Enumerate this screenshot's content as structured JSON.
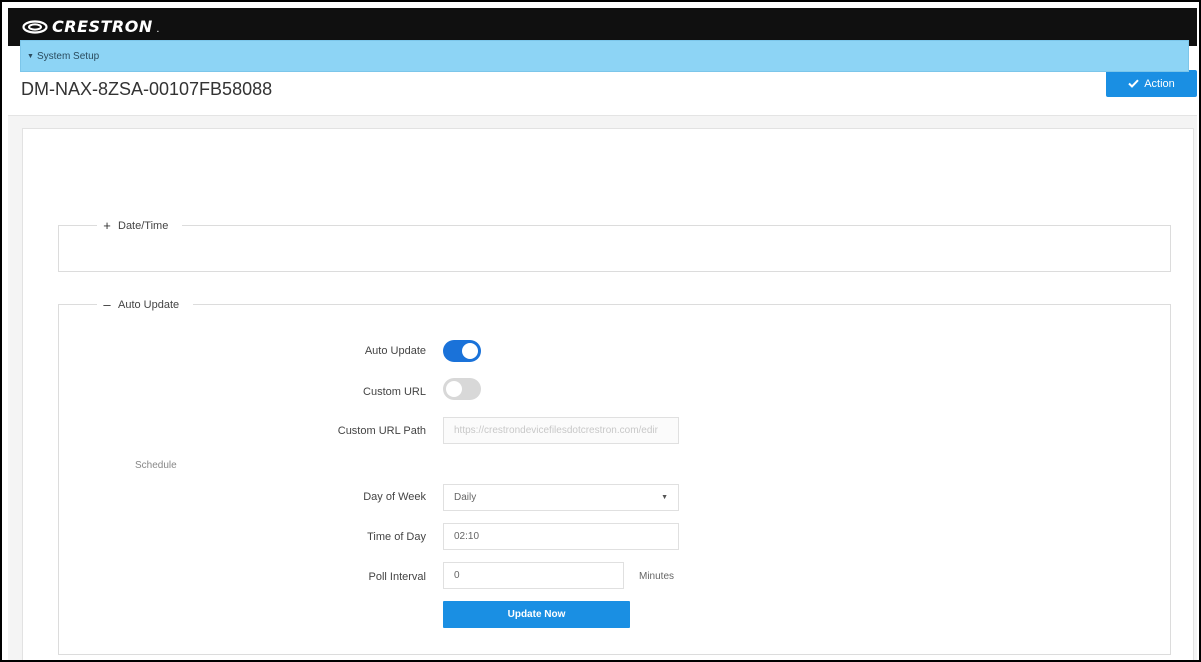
{
  "brand": {
    "name": "CRESTRON",
    "mark": "."
  },
  "header": {
    "device_name": "DM-NAX-8ZSA-00107FB58088",
    "action_label": "Action"
  },
  "section": {
    "title": "System Setup",
    "groups": [
      {
        "title": "Date/Time",
        "expanded": false
      },
      {
        "title": "Auto Update",
        "expanded": true
      }
    ]
  },
  "auto_update": {
    "auto_update_label": "Auto Update",
    "auto_update_enabled": true,
    "custom_url_label": "Custom URL",
    "custom_url_enabled": false,
    "custom_url_path_label": "Custom URL Path",
    "custom_url_path_value": "https://crestrondevicefilesdotcrestron.com/edir",
    "schedule_label": "Schedule",
    "day_of_week_label": "Day of Week",
    "day_of_week_value": "Daily",
    "time_of_day_label": "Time of Day",
    "time_of_day_value": "02:10",
    "poll_interval_label": "Poll Interval",
    "poll_interval_value": "0",
    "poll_interval_unit": "Minutes",
    "update_now_label": "Update Now"
  },
  "colors": {
    "accent": "#1a8fe3",
    "toggle_on": "#1a72d9",
    "section_header": "#8dd4f5",
    "topbar": "#101010"
  }
}
